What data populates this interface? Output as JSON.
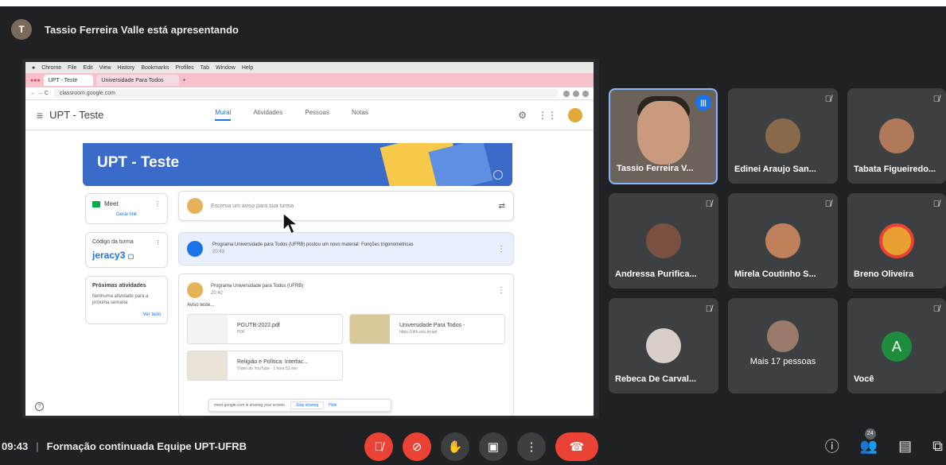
{
  "presenter": {
    "initial": "T",
    "text": "Tassio Ferreira Valle está apresentando"
  },
  "shared_screen": {
    "mac_menu": [
      "Chrome",
      "File",
      "Edit",
      "View",
      "History",
      "Bookmarks",
      "Profiles",
      "Tab",
      "Window",
      "Help"
    ],
    "tabs": [
      "UPT - Teste",
      "Universidade Para Todos"
    ],
    "url": "classroom.google.com",
    "class_title_nav": "UPT - Teste",
    "nav_tabs": [
      "Mural",
      "Atividades",
      "Pessoas",
      "Notas"
    ],
    "banner_title": "UPT - Teste",
    "meet_label": "Meet",
    "meet_link": "Gerar link",
    "code_label": "Código da turma",
    "code_value": "jeracy3",
    "due_title": "Próximas atividades",
    "due_text": "Nenhuma atividade para a próxima semana",
    "due_link": "Ver tudo",
    "announce_placeholder": "Escreva um aviso para sua turma",
    "material_text": "Programa Universidade para Todos (UFRB) postou um novo material: Funções trigonométricas",
    "material_date": "20:43",
    "post_author": "Programa Universidade para Todos (UFRB)",
    "post_date": "20:42",
    "post_body": "Aviso teste...",
    "attachments": [
      {
        "title": "PGUTB-2022.pdf",
        "sub": "PDF"
      },
      {
        "title": "Universidade Para Todos -",
        "sub": "https://ufrb.edu.br/upt"
      },
      {
        "title": "Religião e Política: Interfac...",
        "sub": "Vídeo do YouTube · 1 hora 52 min"
      }
    ],
    "sharing_msg": "meet.google.com is sharing your screen.",
    "stop_sharing": "Stop sharing",
    "hide": "Hide"
  },
  "participants": [
    {
      "name": "Tassio Ferreira V...",
      "speaking": true,
      "color": "#6b625a"
    },
    {
      "name": "Edinei Araujo San...",
      "color": "#8a6a4a"
    },
    {
      "name": "Tabata Figueiredo...",
      "color": "#b07a5a"
    },
    {
      "name": "Andressa Purifica...",
      "color": "#7a5040"
    },
    {
      "name": "Mirela Coutinho S...",
      "color": "#c0805a"
    },
    {
      "name": "Breno Oliveira",
      "color": "#e8a030"
    },
    {
      "name": "Rebeca De Carval...",
      "color": "#d8d0c8"
    },
    {
      "name": "Mais 17 pessoas",
      "color": "#9a7a6a"
    },
    {
      "name": "Você",
      "initial": "A",
      "color": "#1e8e3e"
    }
  ],
  "meeting": {
    "time": "09:43",
    "separator": "|",
    "title": "Formação continuada Equipe UPT-UFRB"
  },
  "people_count": "24",
  "icons": {
    "mute": "mic-off-icon",
    "camera": "camera-off-icon",
    "hand": "raise-hand-icon",
    "present": "present-icon",
    "more": "more-icon",
    "hangup": "hangup-icon",
    "info": "info-icon",
    "people": "people-icon",
    "chat": "chat-icon",
    "activities": "activities-icon"
  }
}
